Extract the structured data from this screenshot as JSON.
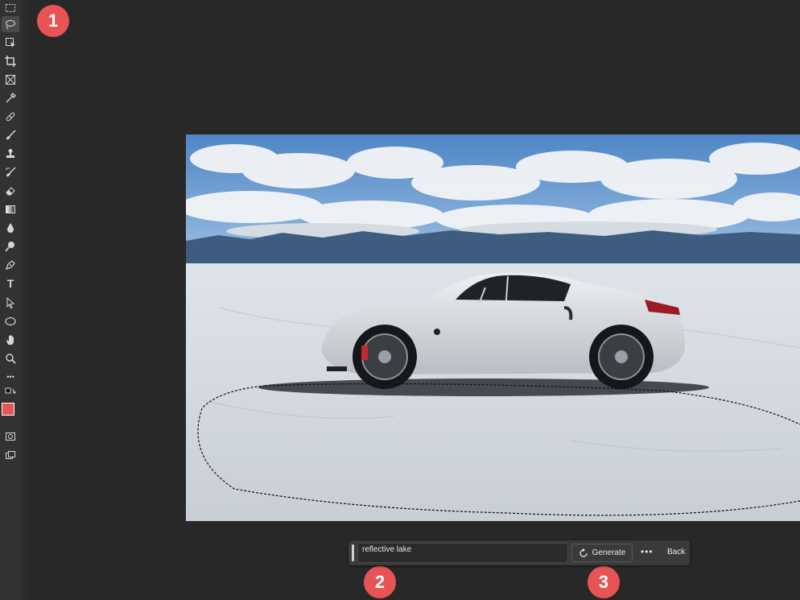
{
  "toolbar": {
    "tools": [
      {
        "name": "marquee-tool"
      },
      {
        "name": "lasso-tool",
        "active": true
      },
      {
        "name": "object-selection-tool"
      },
      {
        "name": "crop-tool"
      },
      {
        "name": "frame-tool"
      },
      {
        "name": "eyedropper-tool"
      },
      {
        "name": "healing-brush-tool"
      },
      {
        "name": "brush-tool"
      },
      {
        "name": "clone-stamp-tool"
      },
      {
        "name": "history-brush-tool"
      },
      {
        "name": "eraser-tool"
      },
      {
        "name": "gradient-tool"
      },
      {
        "name": "blur-tool"
      },
      {
        "name": "dodge-tool"
      },
      {
        "name": "pen-tool"
      },
      {
        "name": "type-tool",
        "glyph": "T"
      },
      {
        "name": "path-selection-tool"
      },
      {
        "name": "ellipse-tool"
      },
      {
        "name": "hand-tool"
      },
      {
        "name": "zoom-tool"
      },
      {
        "name": "more-tools",
        "glyph": "•••"
      }
    ],
    "foreground_color": "#e85556",
    "background_color": "#ffffff"
  },
  "badges": {
    "one": "1",
    "two": "2",
    "three": "3"
  },
  "contextual_taskbar": {
    "prompt_value": "reflective lake",
    "generate_label": "Generate",
    "more_label": "•••",
    "back_label": "Back"
  }
}
